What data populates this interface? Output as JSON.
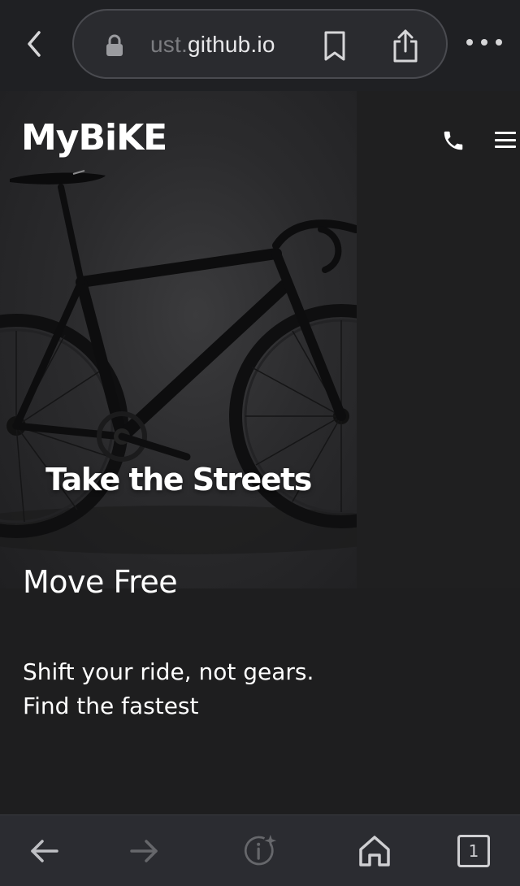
{
  "browser": {
    "url_faded": "ust.",
    "url_main": "github.io",
    "tab_count": "1"
  },
  "site": {
    "logo": "MyBiKE",
    "hero_title": "Take the Streets"
  },
  "content": {
    "section_title": "Move Free",
    "section_body": "Shift your ride, not gears. Find the fastest"
  },
  "colors": {
    "page_bg": "#1e1e1f",
    "toolbar_bg": "#2b2c31",
    "topbar_bg": "#1f2023"
  },
  "icons": {
    "back": "chevron-left-icon",
    "lock": "lock-icon",
    "bookmark": "bookmark-icon",
    "share": "share-icon",
    "more": "more-dots-icon",
    "phone": "phone-icon",
    "menu": "hamburger-icon",
    "nav_back": "arrow-left-icon",
    "nav_forward": "arrow-right-icon",
    "info": "info-sparkle-icon",
    "home": "home-icon",
    "tabs": "tabs-icon"
  }
}
